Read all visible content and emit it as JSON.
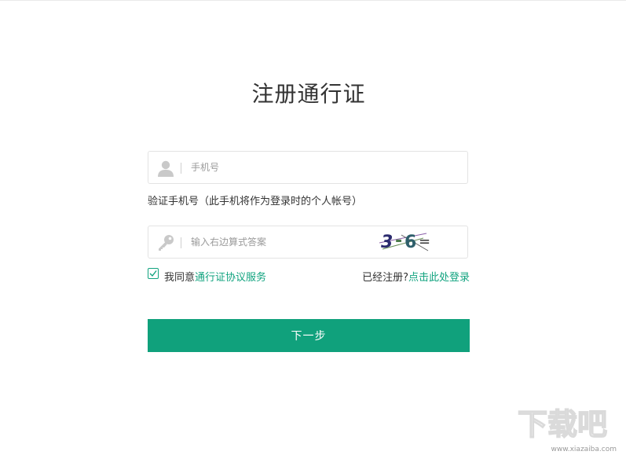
{
  "page": {
    "title": "注册通行证"
  },
  "phone": {
    "placeholder": "手机号",
    "icon": "user-icon",
    "hint": "验证手机号（此手机将作为登录时的个人帐号）"
  },
  "captcha": {
    "placeholder": "输入右边算式答案",
    "icon": "key-icon",
    "image_text": "3-6="
  },
  "agreement": {
    "prefix": "我同意",
    "link": "通行证协议服务",
    "checked": true
  },
  "login": {
    "prefix": "已经注册?",
    "link": "点击此处登录"
  },
  "next_button": {
    "label": "下一步"
  },
  "watermark": {
    "text": "下载吧",
    "url": "www.xiazaiba.com"
  },
  "colors": {
    "accent": "#11a37f",
    "button": "#10a17c",
    "border": "#e3e3e3",
    "text": "#333333",
    "placeholder": "#9b9b9b"
  }
}
